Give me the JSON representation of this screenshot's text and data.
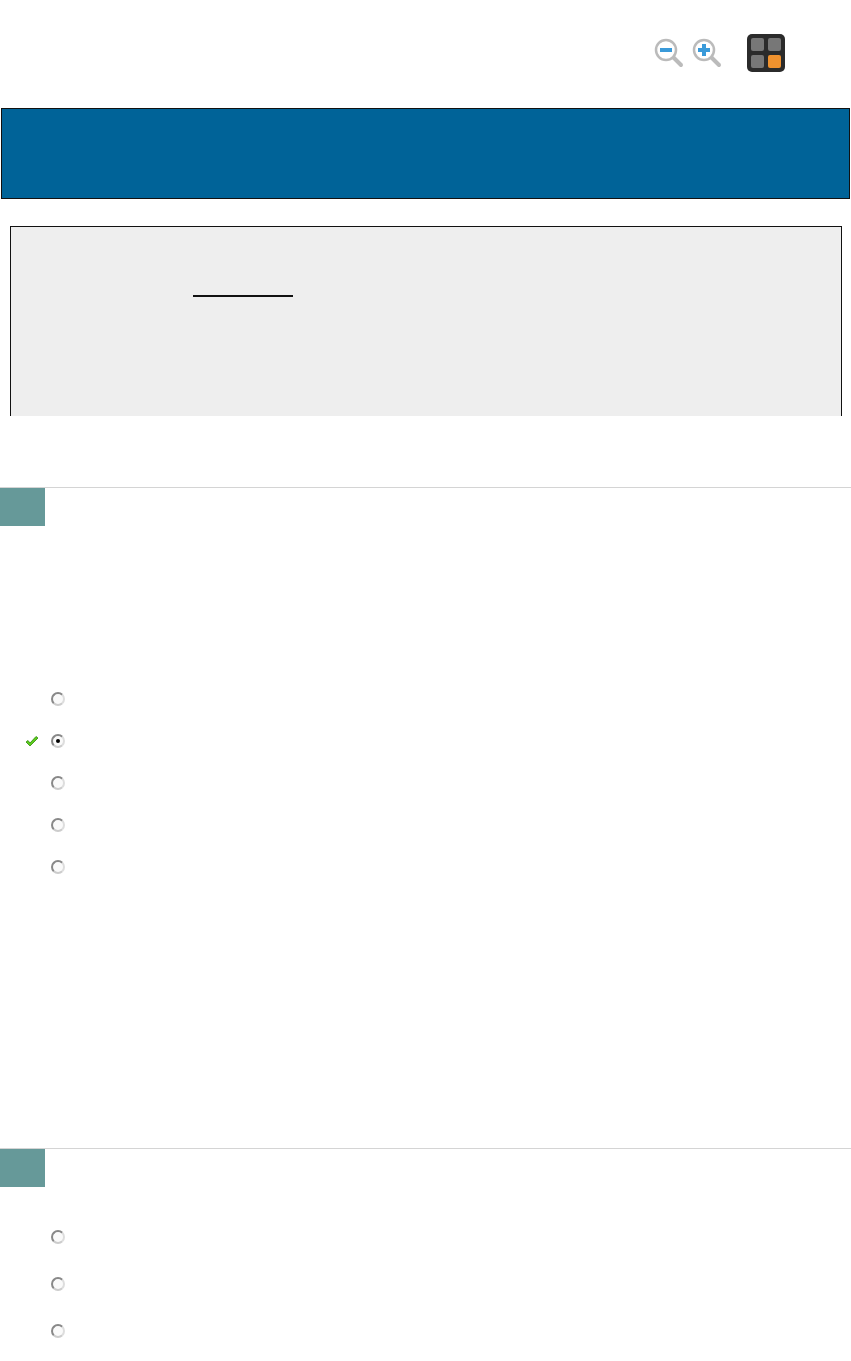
{
  "questions": [
    {
      "options": [
        {
          "selected": false,
          "correct": false
        },
        {
          "selected": true,
          "correct": true
        },
        {
          "selected": false,
          "correct": false
        },
        {
          "selected": false,
          "correct": false
        },
        {
          "selected": false,
          "correct": false
        }
      ]
    },
    {
      "options": [
        {
          "selected": false,
          "correct": false
        },
        {
          "selected": false,
          "correct": false
        },
        {
          "selected": false,
          "correct": false
        }
      ]
    }
  ]
}
